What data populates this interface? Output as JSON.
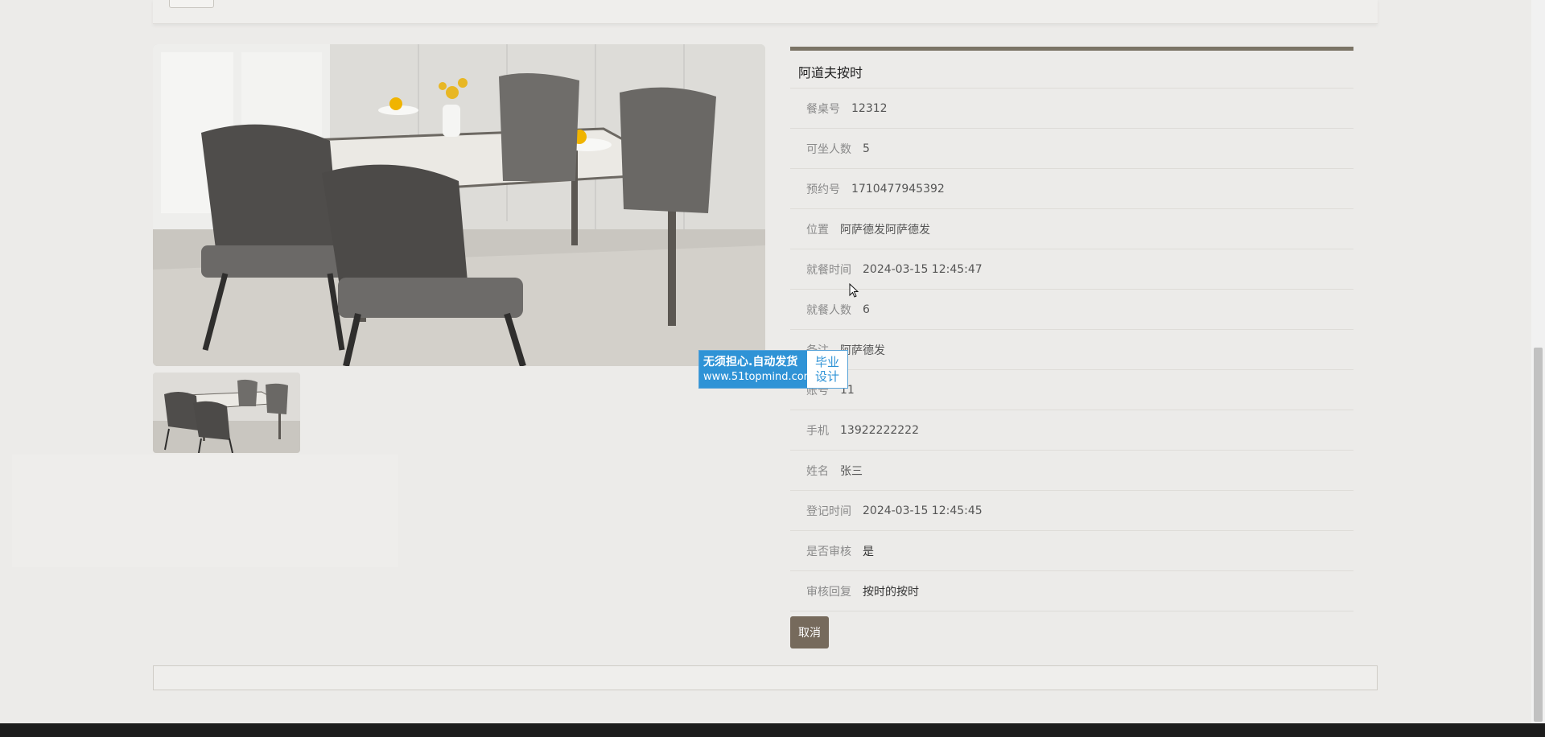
{
  "details": {
    "title": "阿道夫按时",
    "fields": [
      {
        "label": "餐桌号",
        "value": "12312"
      },
      {
        "label": "可坐人数",
        "value": "5"
      },
      {
        "label": "预约号",
        "value": "1710477945392"
      },
      {
        "label": "位置",
        "value": "阿萨德发阿萨德发"
      },
      {
        "label": "就餐时间",
        "value": "2024-03-15 12:45:47"
      },
      {
        "label": "就餐人数",
        "value": "6"
      },
      {
        "label": "备注",
        "value": "阿萨德发"
      },
      {
        "label": "账号",
        "value": "11"
      },
      {
        "label": "手机",
        "value": "13922222222"
      },
      {
        "label": "姓名",
        "value": "张三"
      },
      {
        "label": "登记时间",
        "value": "2024-03-15 12:45:45"
      },
      {
        "label": "是否审核",
        "value": "是"
      },
      {
        "label": "审核回复",
        "value": "按时的按时"
      }
    ],
    "cancel_label": "取消"
  },
  "watermark": {
    "line1": "无须担心.自动发货",
    "line2": "www.51topmind.com",
    "badge_top": "毕业",
    "badge_bottom": "设计"
  },
  "colors": {
    "accent": "#7b7466",
    "button": "#766a5c",
    "watermark_blue": "#2f93d6"
  }
}
